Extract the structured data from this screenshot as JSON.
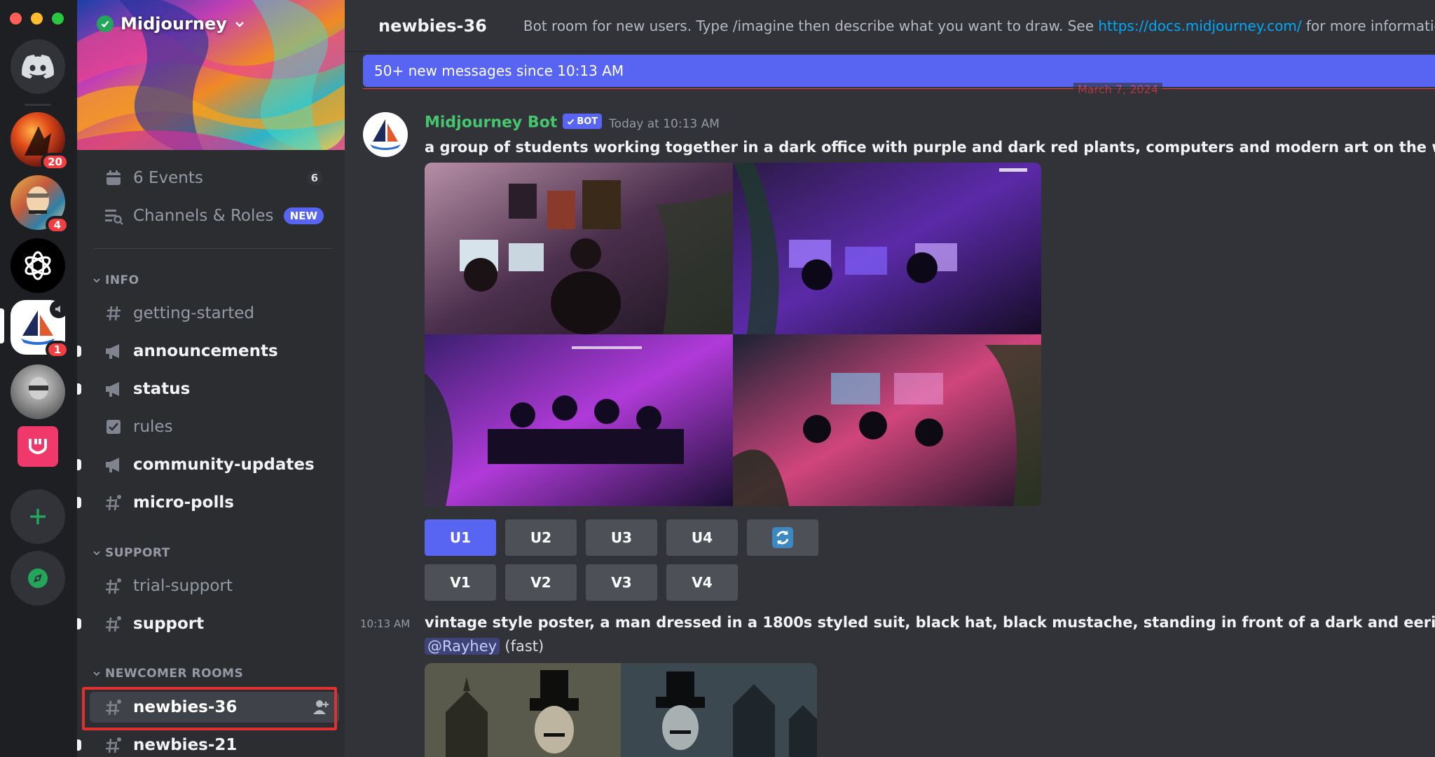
{
  "window": {
    "controls": [
      "close",
      "minimize",
      "zoom"
    ],
    "control_colors": [
      "#ff5f57",
      "#febc2e",
      "#28c840"
    ]
  },
  "rail": {
    "servers": [
      {
        "name": "discord-home",
        "icon": "discord-logo-icon"
      },
      {
        "name": "server-art-1",
        "badge": "20"
      },
      {
        "name": "server-art-2",
        "badge": "4"
      },
      {
        "name": "openai",
        "icon": "openai-logo-icon"
      },
      {
        "name": "midjourney",
        "icon": "midjourney-sailboat-icon",
        "badge": "1"
      },
      {
        "name": "server-photo"
      },
      {
        "name": "server-pink",
        "icon": "pink-logo-icon"
      },
      {
        "name": "add-server",
        "icon": "plus-icon"
      },
      {
        "name": "explore",
        "icon": "compass-icon"
      }
    ]
  },
  "sidebar": {
    "server_name": "Midjourney",
    "top_items": [
      {
        "label": "6 Events",
        "icon": "calendar-icon",
        "count": "6"
      },
      {
        "label": "Channels & Roles",
        "icon": "channels-roles-icon",
        "badge": "NEW"
      }
    ],
    "categories": [
      {
        "label": "INFO",
        "channels": [
          {
            "label": "getting-started",
            "icon": "hash-icon",
            "unread": false
          },
          {
            "label": "announcements",
            "icon": "megaphone-icon",
            "unread": true
          },
          {
            "label": "status",
            "icon": "megaphone-icon",
            "unread": true
          },
          {
            "label": "rules",
            "icon": "rules-checkbox-icon",
            "unread": false
          },
          {
            "label": "community-updates",
            "icon": "megaphone-icon",
            "unread": true
          },
          {
            "label": "micro-polls",
            "icon": "hash-thread-icon",
            "unread": true
          }
        ]
      },
      {
        "label": "SUPPORT",
        "channels": [
          {
            "label": "trial-support",
            "icon": "hash-thread-icon",
            "unread": false
          },
          {
            "label": "support",
            "icon": "hash-thread-icon",
            "unread": true
          }
        ]
      },
      {
        "label": "NEWCOMER ROOMS",
        "channels": [
          {
            "label": "newbies-36",
            "icon": "hash-thread-icon",
            "active": true,
            "trailing_icon": "invite-member-icon"
          },
          {
            "label": "newbies-21",
            "icon": "hash-thread-icon",
            "unread": true
          }
        ]
      }
    ]
  },
  "header": {
    "channel": "newbies-36",
    "topic_prefix": "Bot room for new users. Type /imagine then describe what you want to draw. See ",
    "topic_link": "https://docs.midjourney.com/",
    "topic_suffix": " for more information"
  },
  "new_messages_bar": "50+ new messages since 10:13 AM",
  "divider_date": "March 7, 2024",
  "messages": [
    {
      "author": "Midjourney Bot",
      "tag": "BOT",
      "timestamp": "Today at 10:13 AM",
      "text": "a group of students working together in a dark office with purple and dark red plants, computers and modern art on the walls. hy",
      "buttons_row1": [
        "U1",
        "U2",
        "U3",
        "U4"
      ],
      "refresh_icon": "refresh-icon",
      "buttons_row2": [
        "V1",
        "V2",
        "V3",
        "V4"
      ]
    },
    {
      "timestamp": "10:13 AM",
      "text": "vintage style poster, a man dressed in a 1800s styled suit, black hat, black mustache, standing in front of a dark and eerie hotel, r",
      "mention": "@Rayhey",
      "mode": "(fast)"
    }
  ],
  "colors": {
    "accent": "#5865f2",
    "highlight_box": "#e03131",
    "bot_name": "#46c46e",
    "link": "#00a8fc"
  }
}
